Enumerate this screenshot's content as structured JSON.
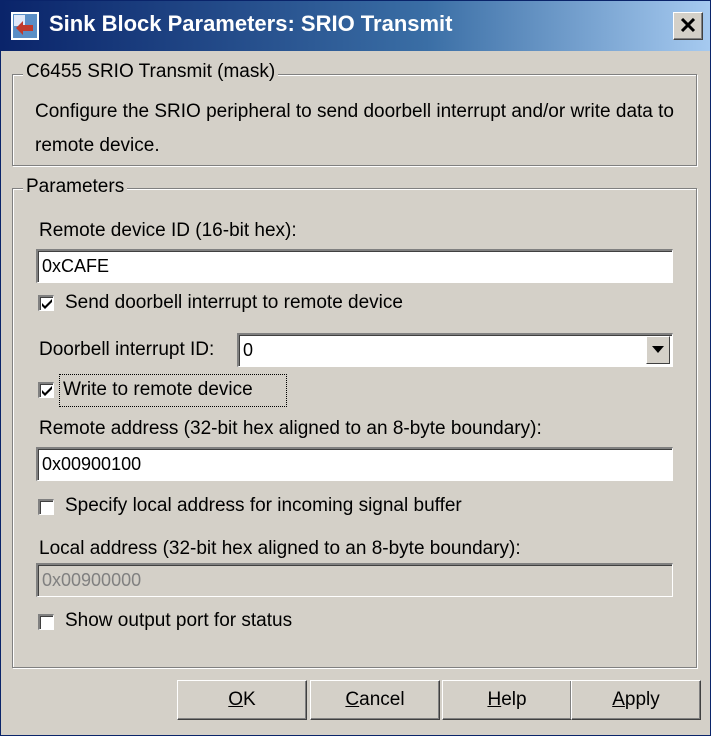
{
  "window": {
    "title": "Sink Block Parameters: SRIO Transmit"
  },
  "mask_group": {
    "legend": "C6455 SRIO Transmit (mask)",
    "description": "Configure the SRIO peripheral to send doorbell interrupt and/or write data to remote device."
  },
  "params_group": {
    "legend": "Parameters",
    "remote_device_id": {
      "label": "Remote device ID (16-bit hex):",
      "value": "0xCAFE"
    },
    "send_doorbell": {
      "label": "Send doorbell interrupt to remote device",
      "checked": true
    },
    "doorbell_id": {
      "label": "Doorbell interrupt ID:",
      "value": "0"
    },
    "write_remote": {
      "label": "Write to remote device",
      "checked": true
    },
    "remote_address": {
      "label": "Remote address (32-bit hex aligned to an 8-byte boundary):",
      "value": "0x00900100"
    },
    "specify_local": {
      "label": "Specify local address for incoming signal buffer",
      "checked": false
    },
    "local_address": {
      "label": "Local address (32-bit hex aligned to an 8-byte boundary):",
      "value": "0x00900000"
    },
    "show_status": {
      "label": "Show output port for status",
      "checked": false
    }
  },
  "buttons": {
    "ok": {
      "mnemonic": "O",
      "rest": "K"
    },
    "cancel": {
      "mnemonic": "C",
      "rest": "ancel"
    },
    "help": {
      "mnemonic": "H",
      "rest": "elp"
    },
    "apply": {
      "mnemonic": "A",
      "rest": "pply"
    }
  },
  "colors": {
    "titlebar_start": "#0a246a",
    "titlebar_end": "#a6caf0",
    "face": "#d4d0c8"
  }
}
